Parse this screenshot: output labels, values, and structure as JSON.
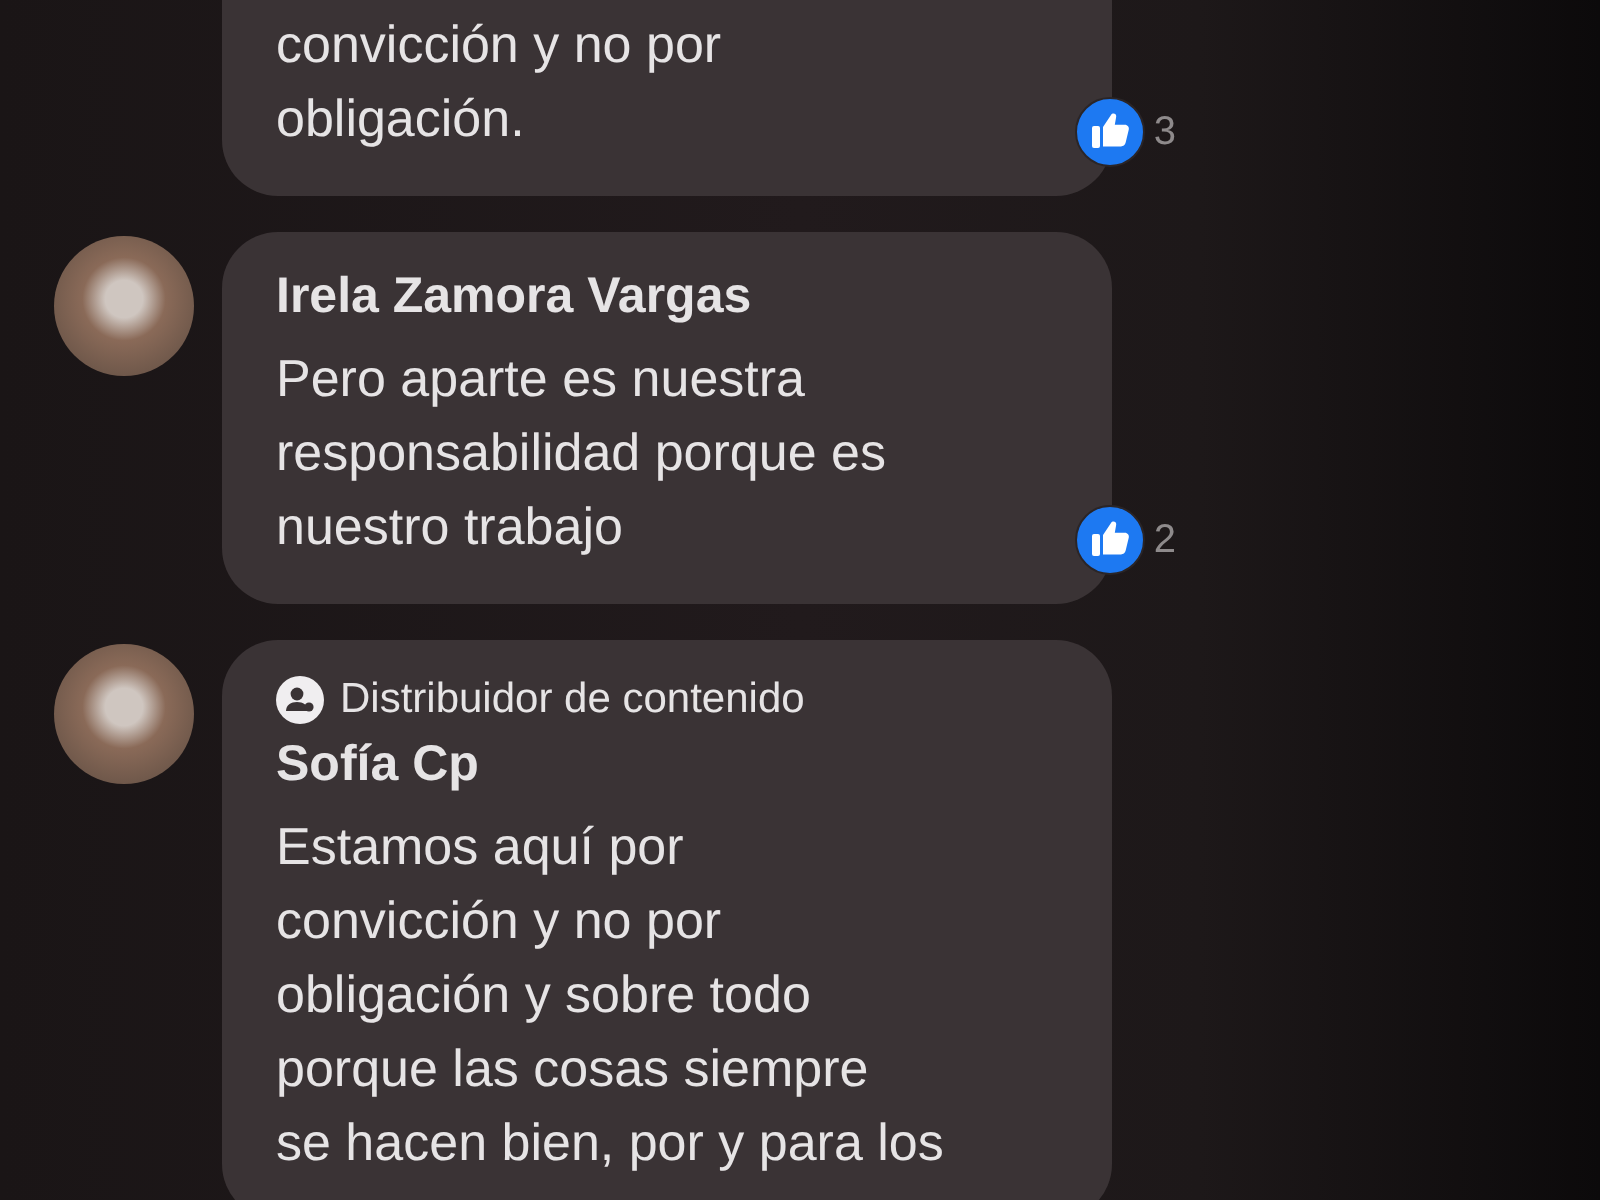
{
  "comments": [
    {
      "text": "convicción y no por\nobligación.",
      "likes": "3"
    },
    {
      "author": "Irela Zamora Vargas",
      "text": "Pero aparte es nuestra\nresponsabilidad porque es\nnuestro trabajo",
      "likes": "2"
    },
    {
      "badge": "Distribuidor de contenido",
      "author": "Sofía Cp",
      "text": "Estamos aquí por\nconvicción y no por\nobligación y sobre todo\nporque las cosas siempre\nse hacen bien, por y para los"
    }
  ]
}
